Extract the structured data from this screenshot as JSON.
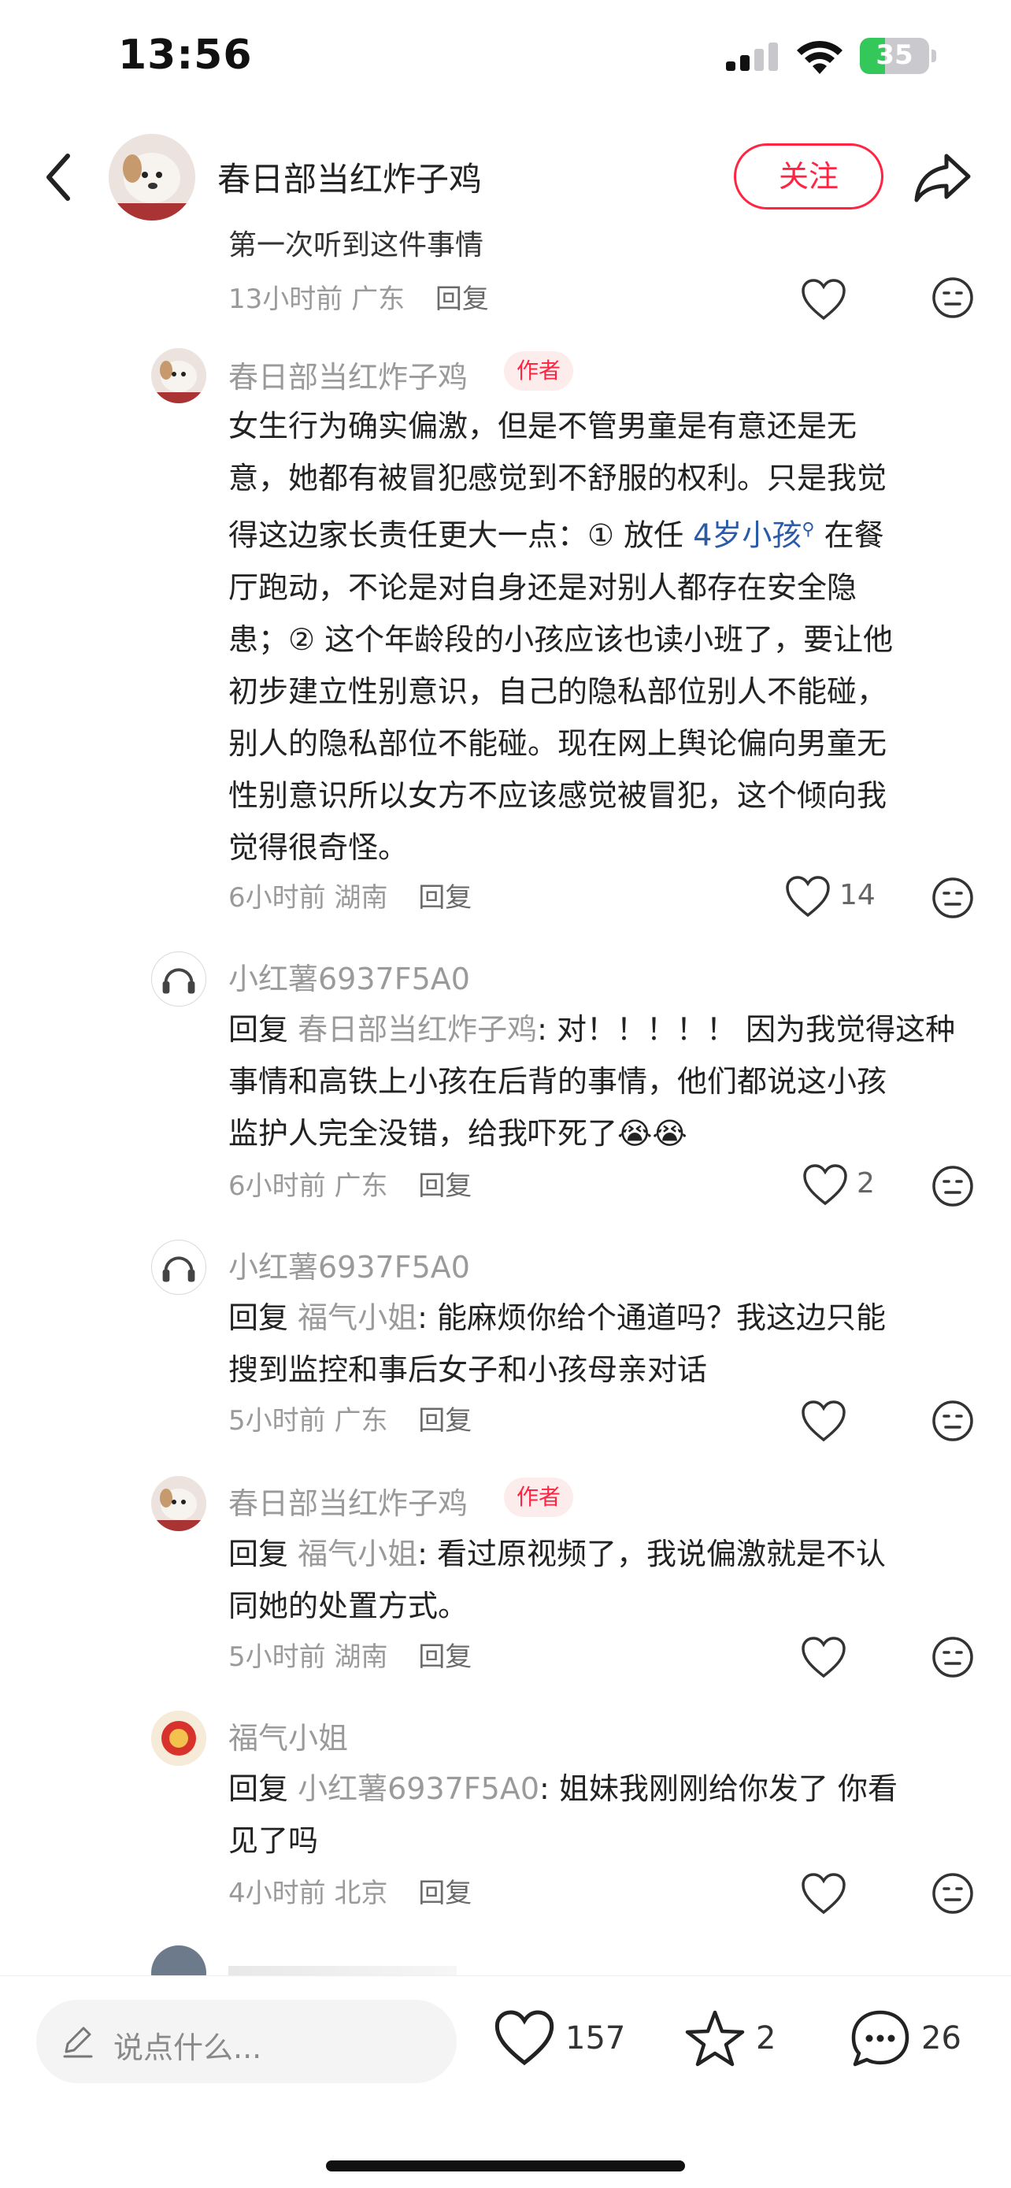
{
  "status": {
    "time": "13:56",
    "battery": "35"
  },
  "header": {
    "title": "春日部当红炸子鸡",
    "follow_label": "关注"
  },
  "partial_text": "第一次听到这件事情",
  "comments": [
    {
      "meta_time": "13小时前",
      "meta_region": "广东",
      "reply_label": "回复"
    },
    {
      "name": "春日部当红炸子鸡",
      "tag": "作者",
      "lines": [
        "女生行为确实偏激，但是不管男童是有意还是无",
        "意，她都有被冒犯感觉到不舒服的权利。只是我觉",
        "得这边家长责任更大一点：① 放任 ",
        "厅跑动，不论是对自身还是对别人都存在安全隐",
        "患；② 这个年龄段的小孩应该也读小班了，要让他",
        "初步建立性别意识，自己的隐私部位别人不能碰，",
        "别人的隐私部位不能碰。现在网上舆论偏向男童无",
        "性别意识所以女方不应该感觉被冒犯，这个倾向我",
        "觉得很奇怪。"
      ],
      "link": "4岁小孩",
      "line3_tail": " 在餐",
      "meta_time": "6小时前",
      "meta_region": "湖南",
      "reply_label": "回复",
      "likes": "14"
    },
    {
      "name": "小红薯6937F5A0",
      "reply_prefix": "回复 ",
      "reply_to": "春日部当红炸子鸡",
      "lines": [
        ": 对！！！！！ 因为我觉得这种",
        "事情和高铁上小孩在后背的事情，他们都说这小孩",
        "监护人完全没错，给我吓死了"
      ],
      "emoji": "😭😭",
      "meta_time": "6小时前",
      "meta_region": "广东",
      "reply_label": "回复",
      "likes": "2"
    },
    {
      "name": "小红薯6937F5A0",
      "reply_prefix": "回复 ",
      "reply_to": "福气小姐",
      "lines": [
        ": 能麻烦你给个通道吗？我这边只能",
        "搜到监控和事后女子和小孩母亲对话"
      ],
      "meta_time": "5小时前",
      "meta_region": "广东",
      "reply_label": "回复"
    },
    {
      "name": "春日部当红炸子鸡",
      "tag": "作者",
      "reply_prefix": "回复 ",
      "reply_to": "福气小姐",
      "lines": [
        ": 看过原视频了，我说偏激就是不认",
        "同她的处置方式。"
      ],
      "meta_time": "5小时前",
      "meta_region": "湖南",
      "reply_label": "回复"
    },
    {
      "name": "福气小姐",
      "reply_prefix": "回复 ",
      "reply_to": "小红薯6937F5A0",
      "lines": [
        ": 姐妹我刚刚给你发了 你看",
        "见了吗"
      ],
      "meta_time": "4小时前",
      "meta_region": "北京",
      "reply_label": "回复"
    }
  ],
  "bottom": {
    "input_placeholder": "说点什么...",
    "likes": "157",
    "stars": "2",
    "comments": "26"
  },
  "colors": {
    "accent": "#ff2442",
    "link": "#2a5ba8",
    "muted": "#9a9a9a"
  }
}
